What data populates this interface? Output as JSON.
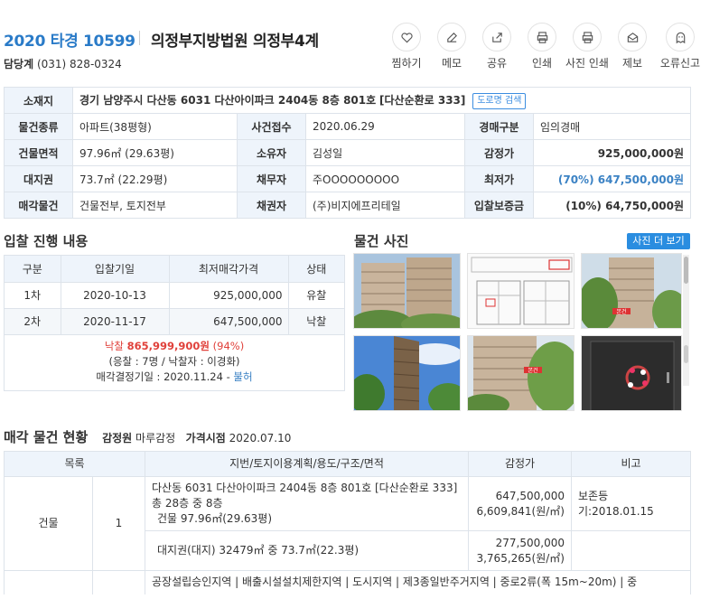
{
  "header": {
    "case_number": "2020 타경 10599",
    "court": "의정부지방법원 의정부4계",
    "contact_label": "담당계",
    "contact_phone": "(031) 828-0324"
  },
  "actions": [
    {
      "label": "찜하기",
      "icon": "heart-icon"
    },
    {
      "label": "메모",
      "icon": "edit-icon"
    },
    {
      "label": "공유",
      "icon": "share-icon"
    },
    {
      "label": "인쇄",
      "icon": "print-icon"
    },
    {
      "label": "사진 인쇄",
      "icon": "photo-print-icon"
    },
    {
      "label": "제보",
      "icon": "mail-icon"
    },
    {
      "label": "오류신고",
      "icon": "ghost-icon"
    }
  ],
  "info": {
    "location_label": "소재지",
    "location_value": "경기 남양주시 다산동 6031 다산아이파크 2404동 8층 801호",
    "location_road": "[다산순환로 333]",
    "road_button": "도로명 검색",
    "type_label": "물건종류",
    "type_value": "아파트(38평형)",
    "case_received_label": "사건접수",
    "case_received_value": "2020.06.29",
    "auction_type_label": "경매구분",
    "auction_type_value": "임의경매",
    "building_area_label": "건물면적",
    "building_area_value": "97.96㎡ (29.63평)",
    "owner_label": "소유자",
    "owner_value": "김성일",
    "appraisal_label": "감정가",
    "appraisal_value": "925,000,000원",
    "land_label": "대지권",
    "land_value": "73.7㎡ (22.29평)",
    "debtor_label": "채무자",
    "debtor_value": "주OOOOOOOOO",
    "min_price_label": "최저가",
    "min_price_value": "(70%) 647,500,000원",
    "sale_item_label": "매각물건",
    "sale_item_value": "건물전부, 토지전부",
    "creditor_label": "채권자",
    "creditor_value": "(주)비지에프리테일",
    "deposit_label": "입찰보증금",
    "deposit_value": "(10%) 64,750,000원"
  },
  "bid": {
    "title": "입찰 진행 내용",
    "headers": [
      "구분",
      "입찰기일",
      "최저매각가격",
      "상태"
    ],
    "rows": [
      [
        "1차",
        "2020-10-13",
        "925,000,000",
        "유찰"
      ],
      [
        "2차",
        "2020-11-17",
        "647,500,000",
        "낙찰"
      ]
    ],
    "result_prefix": "낙찰",
    "result_amount": "865,999,900원",
    "result_pct": "(94%)",
    "result_detail": "(응찰 : 7명 / 낙찰자 : 이경화)",
    "decision_label": "매각결정기일 : 2020.11.24 - ",
    "decision_status": "불허"
  },
  "photos": {
    "title": "물건 사진",
    "more_button": "사진 더 보기",
    "tag": "본건"
  },
  "sale": {
    "title": "매각 물건 현황",
    "appraiser_label": "감정원",
    "appraiser_value": "마루감정",
    "price_date_label": "가격시점",
    "price_date_value": "2020.07.10",
    "headers": [
      "목록",
      "지번/토지이용계획/용도/구조/면적",
      "감정가",
      "비고"
    ],
    "row_category": "건물",
    "row_number": "1",
    "row_desc_1": "다산동 6031 다산아이파크 2404동 8층 801호 [다산순환로 333] 총 28층 중 8층",
    "row_desc_2": "건물 97.96㎡(29.63평)",
    "row_price_1": "647,500,000",
    "row_unit_1": "6,609,841(원/㎡)",
    "row_note_1": "보존등",
    "row_note_2": "기:2018.01.15",
    "land_desc": "대지권(대지) 32479㎡ 중 73.7㎡(22.3평)",
    "land_price": "277,500,000",
    "land_unit": "3,765,265(원/㎡)",
    "zone_text": "공장설립승인지역 | 배출시설설치제한지역 | 도시지역 | 제3종일반주거지역 | 중로2류(폭 15m~20m) | 중"
  }
}
